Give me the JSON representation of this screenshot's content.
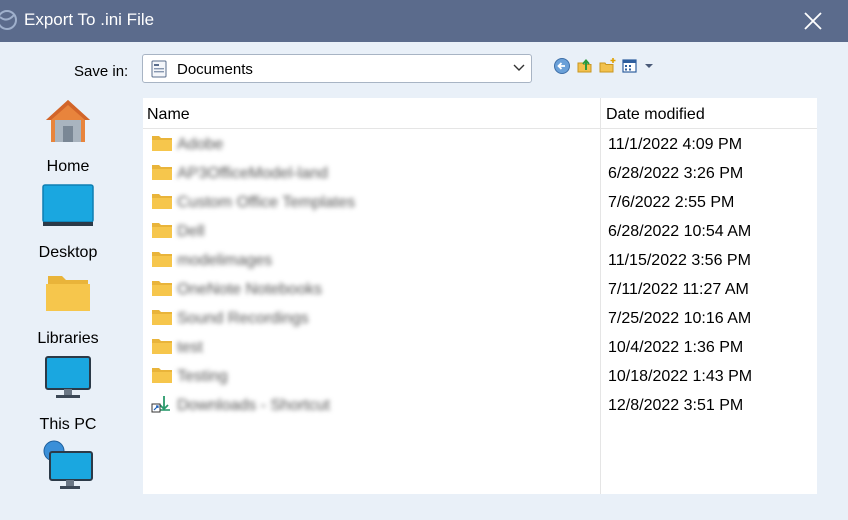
{
  "window": {
    "title": "Export To .ini File"
  },
  "toolbar": {
    "save_in_label": "Save in:",
    "location": "Documents"
  },
  "places": [
    {
      "label": "Home",
      "icon": "home-icon"
    },
    {
      "label": "Desktop",
      "icon": "desktop-icon"
    },
    {
      "label": "Libraries",
      "icon": "libraries-icon"
    },
    {
      "label": "This PC",
      "icon": "this-pc-icon"
    },
    {
      "label": "",
      "icon": "network-icon"
    }
  ],
  "columns": {
    "name": "Name",
    "date_modified": "Date modified"
  },
  "files": [
    {
      "name": "Adobe",
      "date": "11/1/2022 4:09 PM",
      "type": "folder"
    },
    {
      "name": "AP3OfficeModel-land",
      "date": "6/28/2022 3:26 PM",
      "type": "folder"
    },
    {
      "name": "Custom Office Templates",
      "date": "7/6/2022 2:55 PM",
      "type": "folder"
    },
    {
      "name": "Dell",
      "date": "6/28/2022 10:54 AM",
      "type": "folder"
    },
    {
      "name": "modelimages",
      "date": "11/15/2022 3:56 PM",
      "type": "folder"
    },
    {
      "name": "OneNote Notebooks",
      "date": "7/11/2022 11:27 AM",
      "type": "folder"
    },
    {
      "name": "Sound Recordings",
      "date": "7/25/2022 10:16 AM",
      "type": "folder"
    },
    {
      "name": "test",
      "date": "10/4/2022 1:36 PM",
      "type": "folder"
    },
    {
      "name": "Testing",
      "date": "10/18/2022 1:43 PM",
      "type": "folder"
    },
    {
      "name": "Downloads - Shortcut",
      "date": "12/8/2022 3:51 PM",
      "type": "shortcut"
    }
  ],
  "colors": {
    "titlebar": "#5b6b8c",
    "background": "#e9f0f8",
    "folder": "#f6c64c"
  }
}
